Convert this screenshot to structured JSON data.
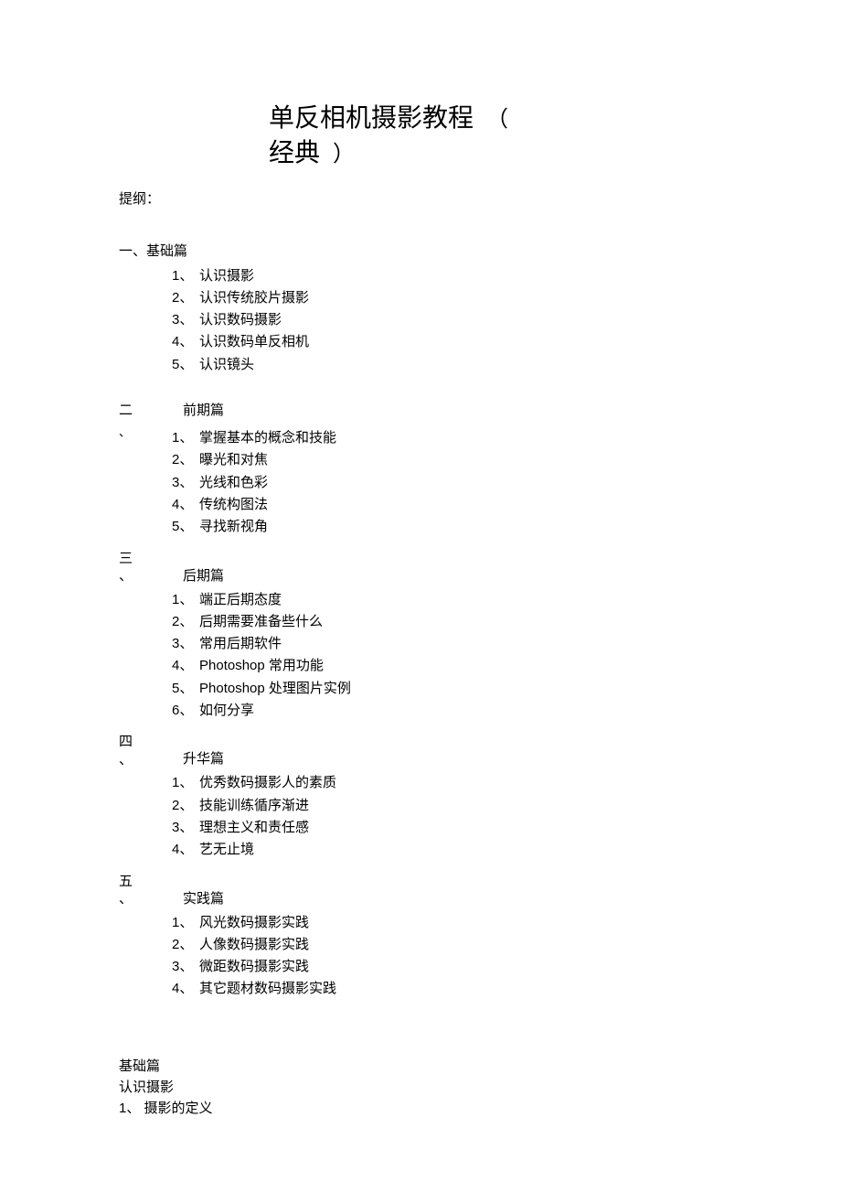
{
  "title": {
    "line1": "单反相机摄影教程",
    "paren_open": "（",
    "line2": "经典",
    "paren_close": "）"
  },
  "outline_label": "提纲：",
  "sections": [
    {
      "marker": "一",
      "sep": "、",
      "title": "基础篇",
      "items": [
        {
          "n": "1",
          "t": "认识摄影"
        },
        {
          "n": "2",
          "t": "认识传统胶片摄影"
        },
        {
          "n": "3",
          "t": "认识数码摄影"
        },
        {
          "n": "4",
          "t": "认识数码单反相机"
        },
        {
          "n": "5",
          "t": "认识镜头"
        }
      ]
    },
    {
      "marker": "二",
      "sep": "、",
      "title": "前期篇",
      "items": [
        {
          "n": "1",
          "t": "掌握基本的概念和技能"
        },
        {
          "n": "2",
          "t": "曝光和对焦"
        },
        {
          "n": "3",
          "t": "光线和色彩"
        },
        {
          "n": "4",
          "t": "传统构图法"
        },
        {
          "n": "5",
          "t": "寻找新视角"
        }
      ]
    },
    {
      "marker": "三",
      "sep": "、",
      "title": "后期篇",
      "items": [
        {
          "n": "1",
          "t": "端正后期态度"
        },
        {
          "n": "2",
          "t": "后期需要准备些什么"
        },
        {
          "n": "3",
          "t": "常用后期软件"
        },
        {
          "n": "4",
          "t": "Photoshop 常用功能"
        },
        {
          "n": "5",
          "t": "Photoshop 处理图片实例"
        },
        {
          "n": "6",
          "t": "如何分享"
        }
      ]
    },
    {
      "marker": "四",
      "sep": "、",
      "title": "升华篇",
      "items": [
        {
          "n": "1",
          "t": "优秀数码摄影人的素质"
        },
        {
          "n": "2",
          "t": "技能训练循序渐进"
        },
        {
          "n": "3",
          "t": "理想主义和责任感"
        },
        {
          "n": "4",
          "t": "艺无止境"
        }
      ]
    },
    {
      "marker": "五",
      "sep": "、",
      "title": "实践篇",
      "items": [
        {
          "n": "1",
          "t": "风光数码摄影实践"
        },
        {
          "n": "2",
          "t": "人像数码摄影实践"
        },
        {
          "n": "3",
          "t": "微距数码摄影实践"
        },
        {
          "n": "4",
          "t": "其它题材数码摄影实践"
        }
      ]
    }
  ],
  "body": {
    "h1": "基础篇",
    "h2": "认识摄影",
    "line": "1、  摄影的定义"
  }
}
